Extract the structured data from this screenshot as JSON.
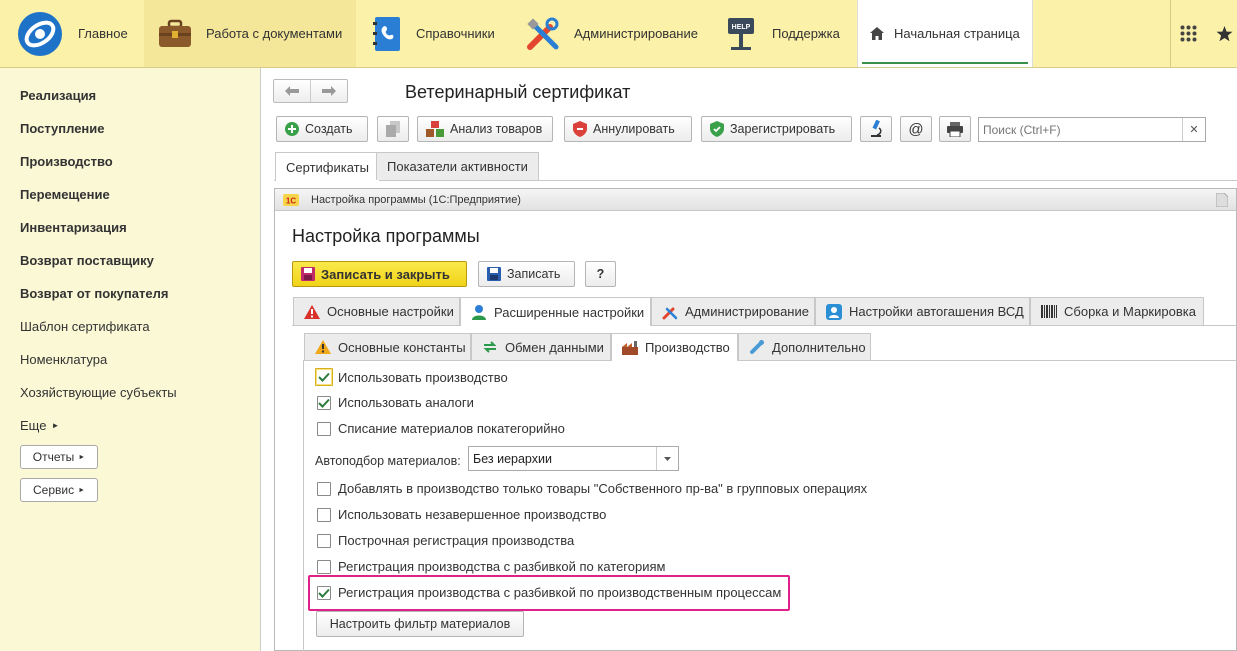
{
  "topbar": {
    "home": "Главное",
    "docs": "Работа с документами",
    "refs": "Справочники",
    "admin": "Администрирование",
    "support": "Поддержка",
    "start": "Начальная страница"
  },
  "leftnav": {
    "items": [
      {
        "label": "Реализация",
        "bold": true
      },
      {
        "label": "Поступление",
        "bold": true
      },
      {
        "label": "Производство",
        "bold": true
      },
      {
        "label": "Перемещение",
        "bold": true
      },
      {
        "label": "Инвентаризация",
        "bold": true
      },
      {
        "label": "Возврат поставщику",
        "bold": true
      },
      {
        "label": "Возврат от покупателя",
        "bold": true
      },
      {
        "label": "Шаблон сертификата",
        "bold": false
      },
      {
        "label": "Номенклатура",
        "bold": false
      },
      {
        "label": "Хозяйствующие субъекты",
        "bold": false
      },
      {
        "label": "Еще",
        "bold": false
      }
    ],
    "reports": "Отчеты",
    "service": "Сервис"
  },
  "doc": {
    "title": "Ветеринарный сертификат",
    "create": "Создать",
    "analysis": "Анализ товаров",
    "annul": "Аннулировать",
    "register": "Зарегистрировать",
    "at": "@",
    "search_placeholder": "Поиск (Ctrl+F)",
    "tabs": [
      "Сертификаты",
      "Показатели активности"
    ]
  },
  "settings": {
    "window_title": "Настройка программы  (1С:Предприятие)",
    "title": "Настройка программы",
    "save_close": "Записать и закрыть",
    "save": "Записать",
    "help": "?",
    "tabs": [
      "Основные настройки",
      "Расширенные настройки",
      "Администрирование",
      "Настройки автогашения ВСД",
      "Сборка и Маркировка"
    ],
    "subtabs": [
      "Основные константы",
      "Обмен данными",
      "Производство",
      "Дополнительно"
    ],
    "checks": [
      {
        "label": "Использовать производство",
        "checked": true
      },
      {
        "label": "Использовать аналоги",
        "checked": true
      },
      {
        "label": "Списание материалов покатегорийно",
        "checked": false
      },
      {
        "label": "Добавлять в производство только товары  \"Собственного пр-ва\" в групповых операциях",
        "checked": false
      },
      {
        "label": "Использовать незавершенное производство",
        "checked": false
      },
      {
        "label": "Построчная регистрация производства",
        "checked": false
      },
      {
        "label": "Регистрация производства с разбивкой по категориям",
        "checked": false
      },
      {
        "label": "Регистрация производства с разбивкой по производственным процессам",
        "checked": true
      }
    ],
    "autoselect_label": "Автоподбор материалов:",
    "autoselect_value": "Без иерархии",
    "filter_button": "Настроить фильтр материалов"
  },
  "colors": {
    "topbar": "#fbf1a9",
    "leftnav": "#fbf8d6",
    "highlight": "#e0218a",
    "accent_green": "#3a8f4a",
    "save_yellow": "#f6df1f"
  }
}
